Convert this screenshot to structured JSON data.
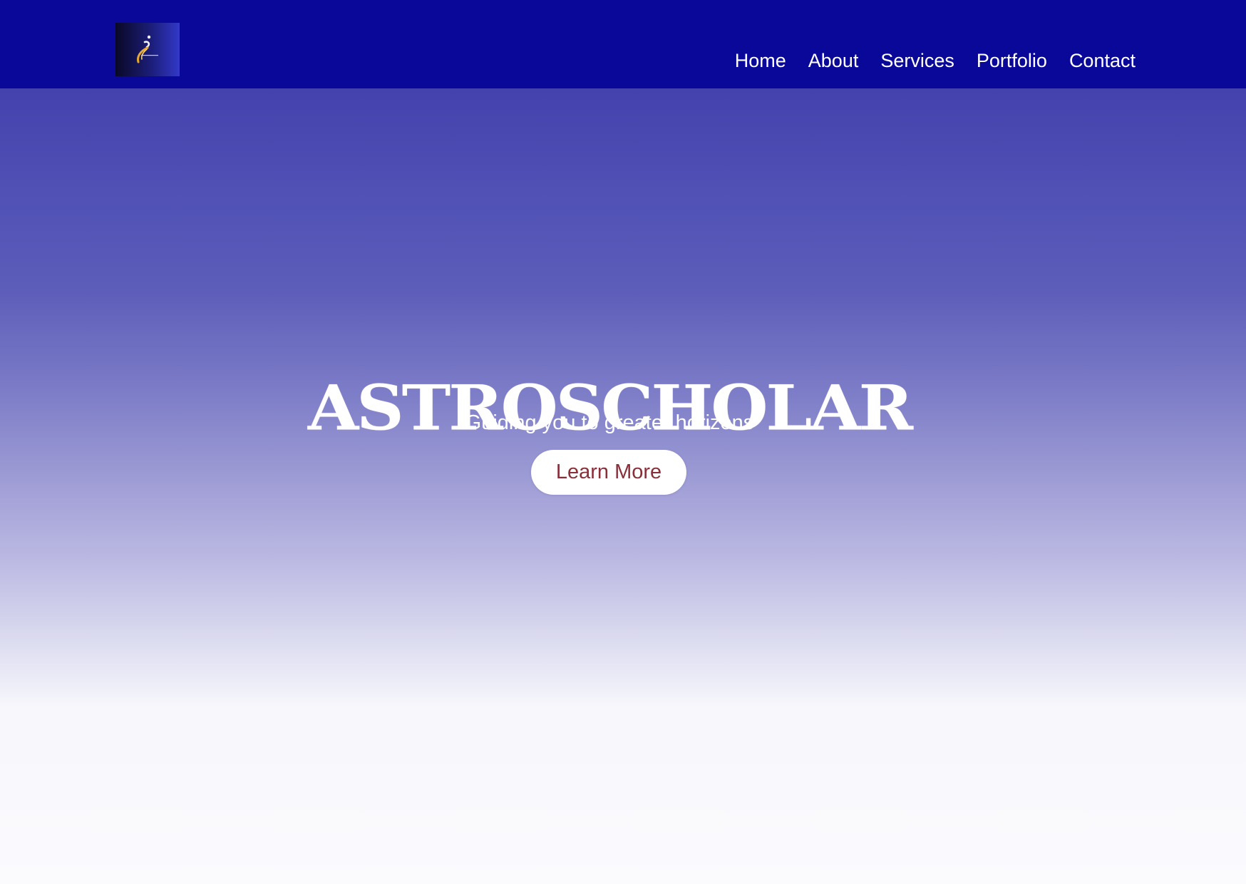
{
  "nav": {
    "logo_icon": "astroscholar-logo",
    "links": [
      "Home",
      "About",
      "Services",
      "Portfolio",
      "Contact"
    ]
  },
  "hero": {
    "title": "ASTROSCHOLAR",
    "subtitle": "Guiding you to greater horizons",
    "cta_label": "Learn More"
  },
  "colors": {
    "navbar": "#090898",
    "hero_top": "#4442ad",
    "hero_bottom": "#fbfbfe",
    "cta_text": "#8a2f3a"
  }
}
